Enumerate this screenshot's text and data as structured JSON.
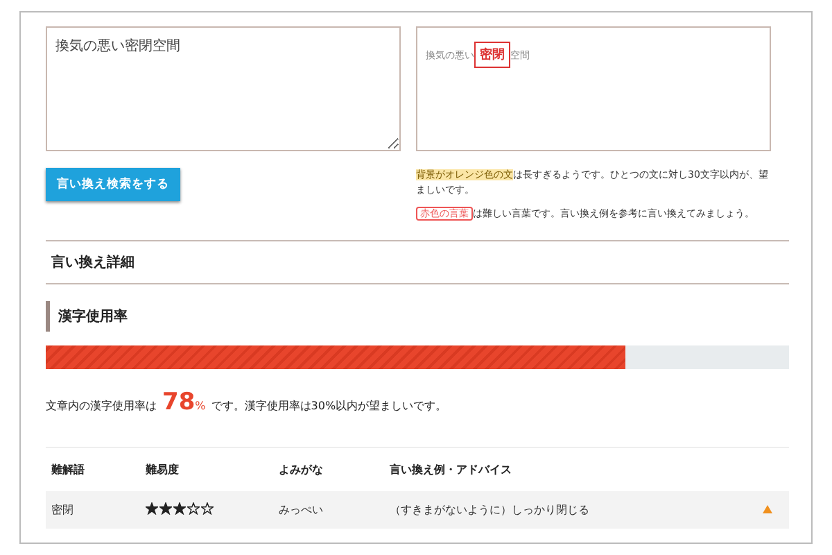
{
  "input": {
    "value": "換気の悪い密閉空間"
  },
  "preview": {
    "segments": [
      {
        "text": "換気の悪い",
        "flagged": false
      },
      {
        "text": "密閉",
        "flagged": true
      },
      {
        "text": "空間",
        "flagged": false
      }
    ]
  },
  "search_button": {
    "label": "言い換え検索をする"
  },
  "notes": [
    {
      "parts": [
        {
          "text": "背景がオレンジ色の文",
          "kind": "highlight"
        },
        {
          "text": "は長すぎるようです。ひとつの文に対し30文字以内が、望ましいです。",
          "kind": "plain"
        }
      ]
    },
    {
      "parts": [
        {
          "text": "赤色の言葉",
          "kind": "boxed"
        },
        {
          "text": "は難しい言葉です。言い換え例を参考に言い換えてみましょう。",
          "kind": "plain"
        }
      ]
    }
  ],
  "details_title": "言い換え詳細",
  "kanji": {
    "title": "漢字使用率",
    "level": 0.78,
    "prefix": "文章内の漢字使用率は",
    "value": "78",
    "unit": "%",
    "suffix": "です。漢字使用率は30%以内が望ましいです。"
  },
  "table": {
    "columns": [
      "難解語",
      "難易度",
      "よみがな",
      "言い換え例・アドバイス"
    ],
    "rows": [
      {
        "word": "密閉",
        "stars": 3,
        "reading": "みっぺい",
        "advice": "（すきまがないように）しっかり閉じる"
      }
    ]
  }
}
